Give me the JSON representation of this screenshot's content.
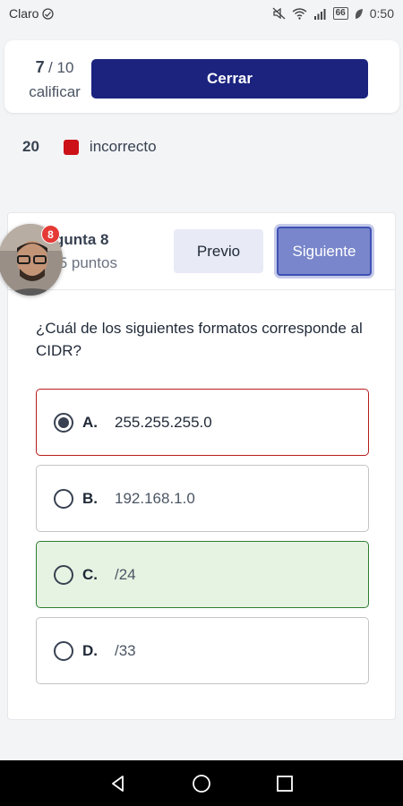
{
  "status_bar": {
    "carrier": "Claro",
    "battery": "66",
    "time": "0:50"
  },
  "score": {
    "current": "7",
    "total": "/ 10",
    "label": "calificar"
  },
  "close_label": "Cerrar",
  "legend": {
    "count": "20",
    "label": "incorrecto",
    "color": "#cc1119"
  },
  "avatar": {
    "badge_count": "8"
  },
  "question": {
    "title": "Pregunta 8",
    "title_visible": "gunta 8",
    "points_visible": ".5 puntos",
    "prev_label": "Previo",
    "next_label": "Siguiente",
    "text": "¿Cuál de los siguientes formatos corresponde al CIDR?",
    "options": [
      {
        "letter": "A.",
        "text": "255.255.255.0",
        "selected": true,
        "state": "incorrect"
      },
      {
        "letter": "B.",
        "text": "192.168.1.0",
        "selected": false,
        "state": "neutral"
      },
      {
        "letter": "C.",
        "text": "/24",
        "selected": false,
        "state": "correct"
      },
      {
        "letter": "D.",
        "text": "/33",
        "selected": false,
        "state": "neutral"
      }
    ]
  },
  "colors": {
    "primary": "#1b237f",
    "accent_next": "#7986cb",
    "correct_bg": "#e6f3e2",
    "incorrect_border": "#b91c1c"
  }
}
